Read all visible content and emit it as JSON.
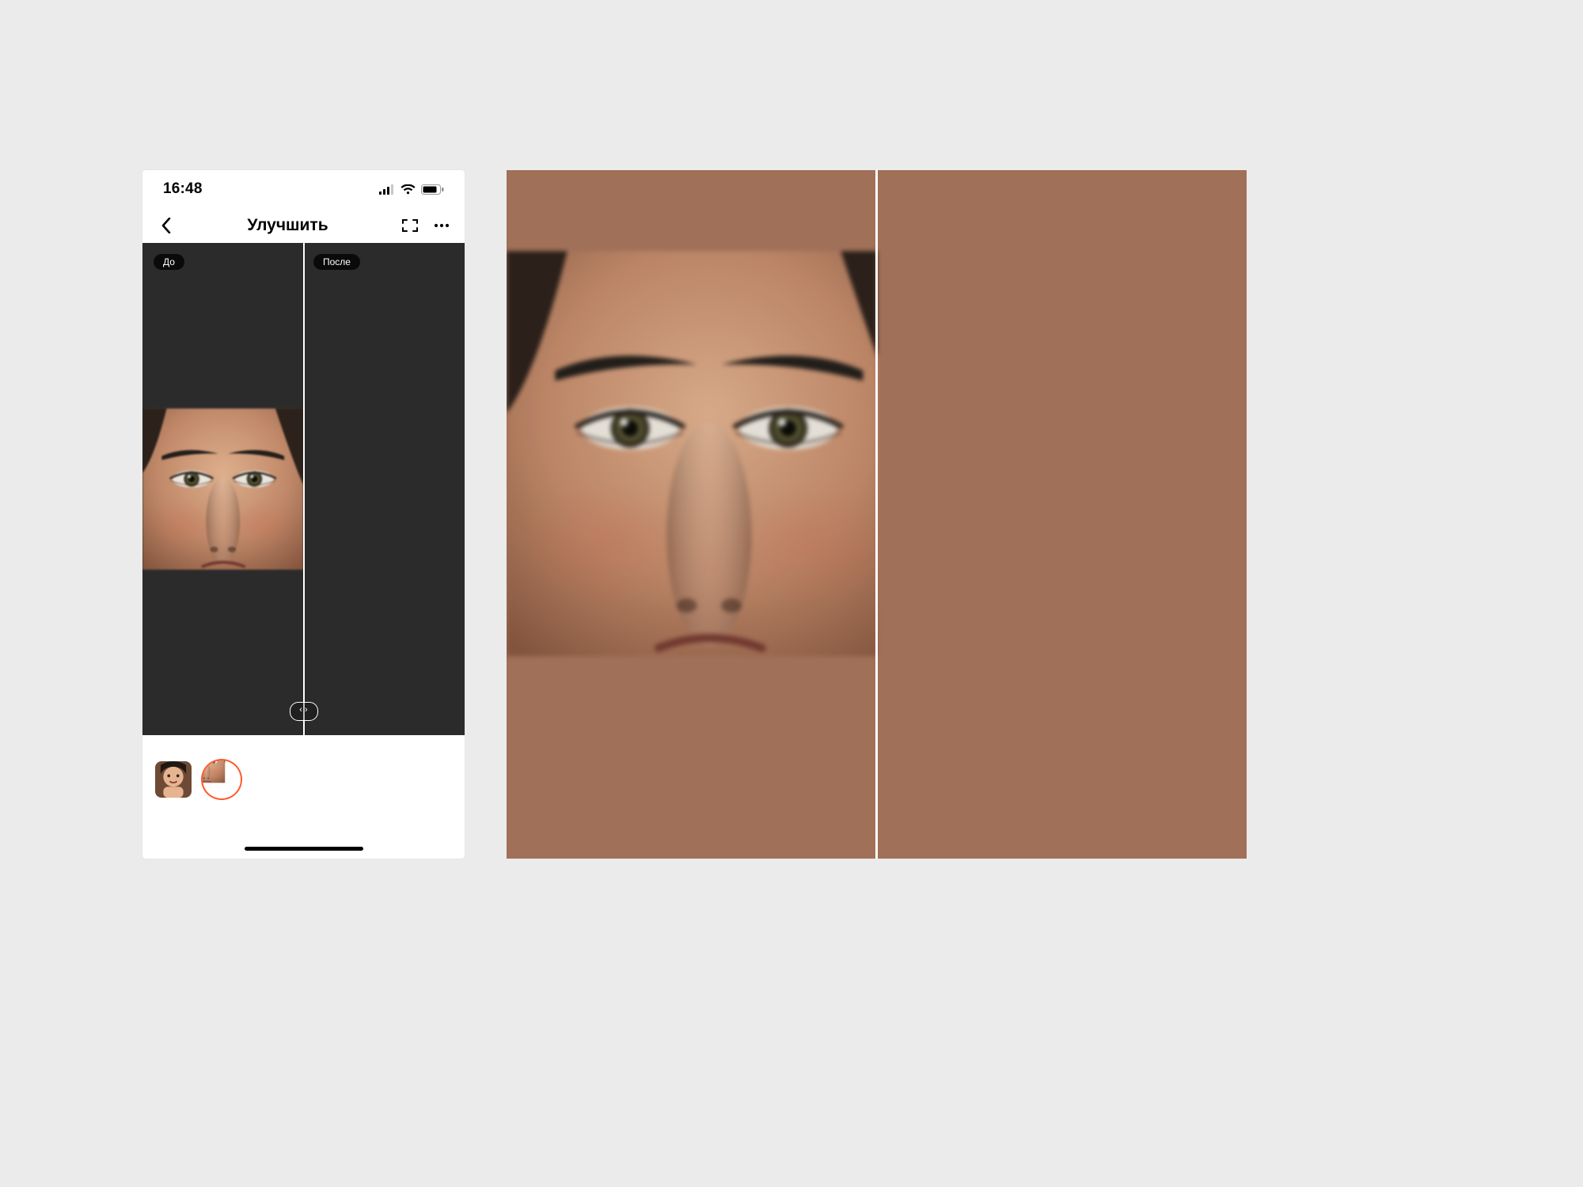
{
  "status": {
    "time": "16:48"
  },
  "nav": {
    "title": "Улучшить"
  },
  "compare": {
    "before_label": "До",
    "after_label": "После",
    "handle_glyph": "‹ ›"
  },
  "thumbnails": {
    "items": [
      {
        "name": "full-photo",
        "selected": false
      },
      {
        "name": "face-crop",
        "selected": true
      }
    ]
  }
}
